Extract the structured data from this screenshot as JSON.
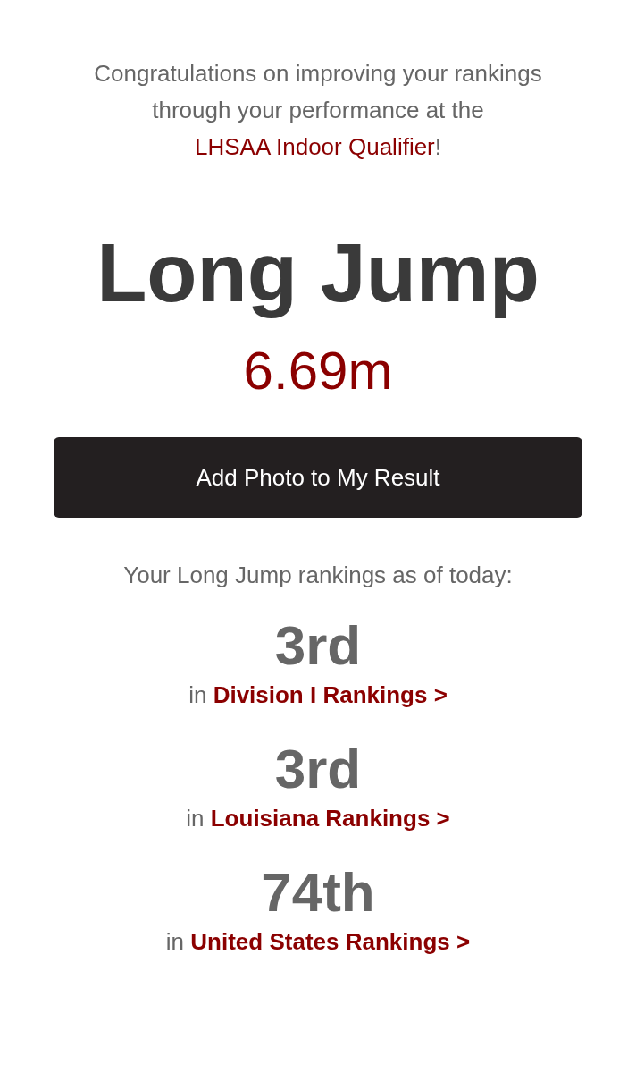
{
  "intro": {
    "text_before": "Congratulations on improving your rankings through your performance at the ",
    "link": "LHSAA Indoor Qualifier",
    "text_after": "!"
  },
  "event": "Long Jump",
  "mark": "6.69m",
  "button": "Add Photo to My Result",
  "rankings_heading": "Your Long Jump rankings as of today:",
  "rankings": [
    {
      "place": "3rd",
      "prefix": "in",
      "link": "Division I Rankings >"
    },
    {
      "place": "3rd",
      "prefix": "in",
      "link": "Louisiana Rankings >"
    },
    {
      "place": "74th",
      "prefix": "in",
      "link": "United States Rankings >"
    }
  ]
}
